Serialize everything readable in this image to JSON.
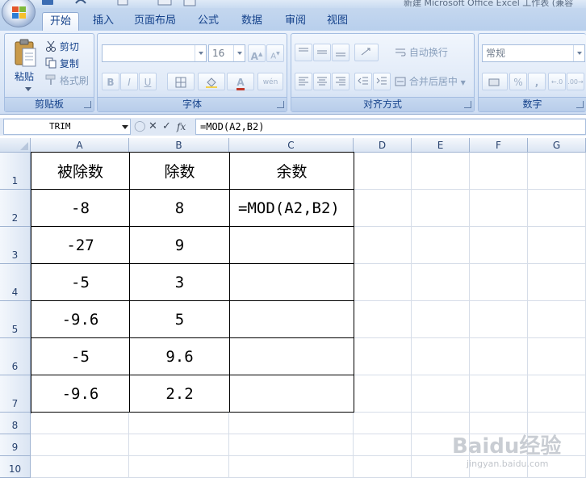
{
  "window": {
    "title": "新建 Microsoft Office Excel 工作表 (兼容"
  },
  "tabs": [
    {
      "label": "开始",
      "active": true
    },
    {
      "label": "插入",
      "active": false
    },
    {
      "label": "页面布局",
      "active": false
    },
    {
      "label": "公式",
      "active": false
    },
    {
      "label": "数据",
      "active": false
    },
    {
      "label": "审阅",
      "active": false
    },
    {
      "label": "视图",
      "active": false
    }
  ],
  "ribbon": {
    "clipboard": {
      "label": "剪贴板",
      "paste": "粘贴",
      "cut": "剪切",
      "copy": "复制",
      "format_painter": "格式刷"
    },
    "font": {
      "label": "字体",
      "font_name": "",
      "font_size": "16",
      "grow": "A",
      "shrink": "A",
      "bold": "B",
      "italic": "I",
      "underline": "U",
      "font_color_glyph": "A",
      "phonetic": "wén"
    },
    "alignment": {
      "label": "对齐方式",
      "wrap_text": "自动换行",
      "merge_center": "合并后居中"
    },
    "number": {
      "label": "数字",
      "format": "常规",
      "percent": "%",
      "comma": ","
    }
  },
  "formula_bar": {
    "name_box": "TRIM",
    "fx": "fx",
    "cancel": "✕",
    "enter": "✓",
    "formula": "=MOD(A2,B2)"
  },
  "sheet": {
    "columns": [
      "A",
      "B",
      "C",
      "D",
      "E",
      "F",
      "G"
    ],
    "rows": [
      "1",
      "2",
      "3",
      "4",
      "5",
      "6",
      "7",
      "8",
      "9",
      "10"
    ],
    "table": {
      "headers": [
        "被除数",
        "除数",
        "余数"
      ],
      "rows": [
        [
          "-8",
          "8",
          "=MOD(A2,B2)"
        ],
        [
          "-27",
          "9",
          ""
        ],
        [
          "-5",
          "3",
          ""
        ],
        [
          "-9.6",
          "5",
          ""
        ],
        [
          "-5",
          "9.6",
          ""
        ],
        [
          "-9.6",
          "2.2",
          ""
        ]
      ]
    }
  },
  "watermark": {
    "brand": "Baidu经验",
    "url": "jingyan.baidu.com"
  },
  "colors": {
    "ribbon_text": "#15428b",
    "ribbon_bg": "#dbe7f7",
    "grid_line": "#d6dde8",
    "header_bg": "#dbe5f3"
  }
}
